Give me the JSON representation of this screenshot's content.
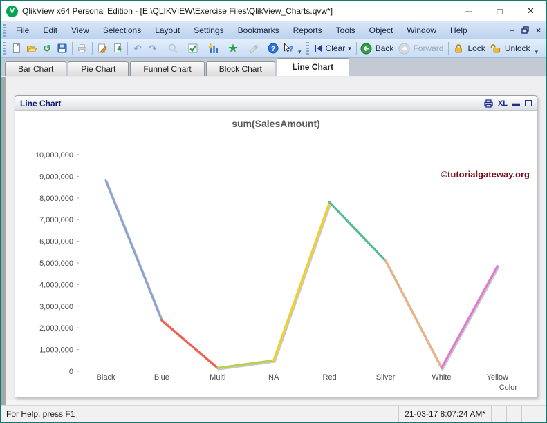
{
  "window": {
    "title": "QlikView x64 Personal Edition - [E:\\QLIKVIEW\\Exercise Files\\QlikView_Charts.qvw*]",
    "app_initial": "V"
  },
  "menu": {
    "items": [
      "File",
      "Edit",
      "View",
      "Selections",
      "Layout",
      "Settings",
      "Bookmarks",
      "Reports",
      "Tools",
      "Object",
      "Window",
      "Help"
    ]
  },
  "toolbar": {
    "clear_label": "Clear",
    "back_label": "Back",
    "forward_label": "Forward",
    "lock_label": "Lock",
    "unlock_label": "Unlock",
    "undo_glyph": "↶",
    "redo_glyph": "↷",
    "refresh_glyph": "↺",
    "star_glyph": "★",
    "caret_glyph": "▾"
  },
  "tabs": [
    {
      "label": "Bar Chart",
      "active": false
    },
    {
      "label": "Pie Chart",
      "active": false
    },
    {
      "label": "Funnel Chart",
      "active": false
    },
    {
      "label": "Block Chart",
      "active": false
    },
    {
      "label": "Line Chart",
      "active": true
    }
  ],
  "chart_window": {
    "caption": "Line Chart",
    "export_label": "XL"
  },
  "watermark": "©tutorialgateway.org",
  "status_bar": {
    "left": "For Help, press F1",
    "right": "21-03-17 8:07:24 AM*"
  },
  "chart_data": {
    "type": "line",
    "title": "sum(SalesAmount)",
    "xlabel": "Color",
    "ylabel": "",
    "categories": [
      "Black",
      "Blue",
      "Multi",
      "NA",
      "Red",
      "Silver",
      "White",
      "Yellow"
    ],
    "values": [
      8800000,
      2350000,
      150000,
      500000,
      7800000,
      5100000,
      150000,
      4850000
    ],
    "ylim": [
      0,
      10000000
    ],
    "ytick_step": 1000000,
    "grid": false,
    "legend": false,
    "segment_colors": [
      "#8aa4d0",
      "#f2604d",
      "#b5d24e",
      "#f2d028",
      "#53bd8d",
      "#e6b488",
      "#e07ad0"
    ],
    "shadow_color": "#c9c9c9",
    "axis_text_color": "#4a4a4a",
    "tick_color": "#aaaaaa"
  }
}
